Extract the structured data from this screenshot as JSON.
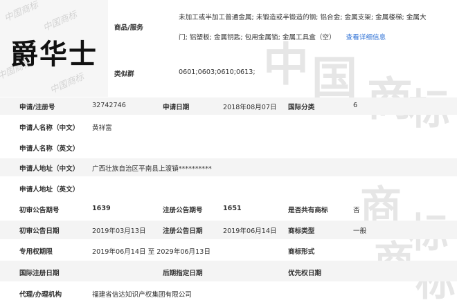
{
  "logo": {
    "mark_text": "爵华士",
    "watermark_text": "中国商标"
  },
  "goods": {
    "label": "商品/服务",
    "line1": "未加工或半加工普通金属; 未锻造或半锻造的钢; 铝合金; 金属支架; 金属楼梯; 金属大",
    "line2": "门; 铝塑板; 金属钥匙; 包用金属锁; 金属工具盒（空）",
    "detail_link": "查看详细信息"
  },
  "similar_group": {
    "label": "类似群",
    "value": "0601;0603;0610;0613;"
  },
  "fields": {
    "reg_no_label": "申请/注册号",
    "reg_no": "32742746",
    "app_date_label": "申请日期",
    "app_date": "2018年08月07日",
    "intl_class_label": "国际分类",
    "intl_class": "6",
    "applicant_cn_label": "申请人名称（中文）",
    "applicant_cn": "黄祥富",
    "applicant_en_label": "申请人名称（英文）",
    "address_cn_label": "申请人地址（中文）",
    "address_cn": "广西壮族自治区平南县上渡镇**********",
    "address_en_label": "申请人地址（英文）",
    "prelim_no_label": "初审公告期号",
    "prelim_no": "1639",
    "reg_pub_no_label": "注册公告期号",
    "reg_pub_no": "1651",
    "shared_label": "是否共有商标",
    "shared": "否",
    "prelim_date_label": "初审公告日期",
    "prelim_date": "2019年03月13日",
    "reg_pub_date_label": "注册公告日期",
    "reg_pub_date": "2019年06月14日",
    "tm_type_label": "商标类型",
    "tm_type": "一般",
    "exclusive_label": "专用权期限",
    "exclusive_period": "2019年06月14日 至 2029年06月13日",
    "tm_form_label": "商标形式",
    "intl_reg_date_label": "国际注册日期",
    "later_designation_label": "后期指定日期",
    "priority_date_label": "优先权日期",
    "agent_label": "代理/办理机构",
    "agent": "福建省信达知识产权集团有限公司"
  },
  "watermark": {
    "text_a": "中",
    "text_b": "国",
    "text_c": "商",
    "text_d": "标"
  }
}
